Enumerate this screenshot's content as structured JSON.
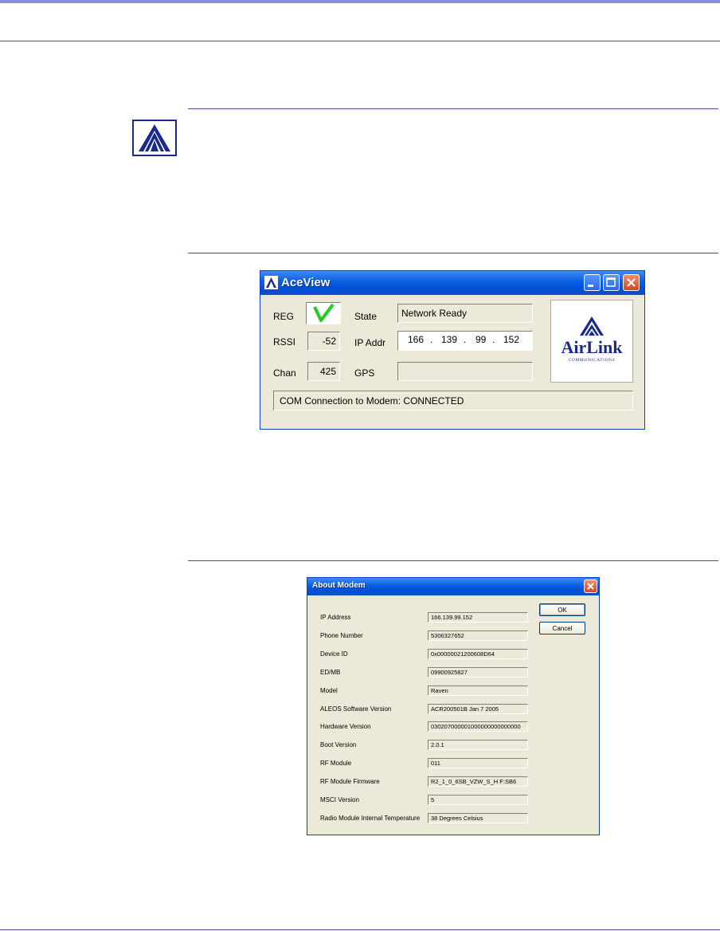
{
  "aceview": {
    "title": "AceView",
    "reg_label": "REG",
    "rssi_label": "RSSI",
    "rssi_value": "-52",
    "chan_label": "Chan",
    "chan_value": "425",
    "state_label": "State",
    "state_value": "Network Ready",
    "ip_label": "IP Addr",
    "ip_octets": [
      "166",
      "139",
      "99",
      "152"
    ],
    "gps_label": "GPS",
    "gps_value": "",
    "status_text": "COM Connection to Modem: CONNECTED",
    "logo_name": "AirLink",
    "logo_sub": "COMMUNICATIONS",
    "reg_icon": "green-check-icon"
  },
  "about": {
    "title": "About Modem",
    "ok_label": "OK",
    "cancel_label": "Cancel",
    "rows": [
      {
        "label": "IP Address",
        "value": "166.139.99.152"
      },
      {
        "label": "Phone Number",
        "value": "5306327652"
      },
      {
        "label": "Device ID",
        "value": "0x00000021200608D64"
      },
      {
        "label": "ED/MB",
        "value": "09900925827"
      },
      {
        "label": "Model",
        "value": "Raven"
      },
      {
        "label": "ALEOS Software Version",
        "value": "ACR200501B Jan  7 2005"
      },
      {
        "label": "Hardware Version",
        "value": "030207000001000000000000000"
      },
      {
        "label": "Boot Version",
        "value": "2.0.1"
      },
      {
        "label": "RF Module",
        "value": "011"
      },
      {
        "label": "RF Module Firmware",
        "value": "R2_1_0_6SB_VZW_S_H F:SB6"
      },
      {
        "label": "MSCI Version",
        "value": "5"
      },
      {
        "label": "Radio Module Internal Temperature",
        "value": "38 Degrees Celsius"
      }
    ]
  },
  "colors": {
    "accent_rule": "#4a4f9c",
    "top_bar": "#8b8fe0",
    "xp_title": "#0a5ee0",
    "check_green": "#22cc22"
  },
  "icons": {
    "note": "airlink-note-icon",
    "minimize": "minimize-icon",
    "maximize": "maximize-icon",
    "close": "close-icon"
  }
}
